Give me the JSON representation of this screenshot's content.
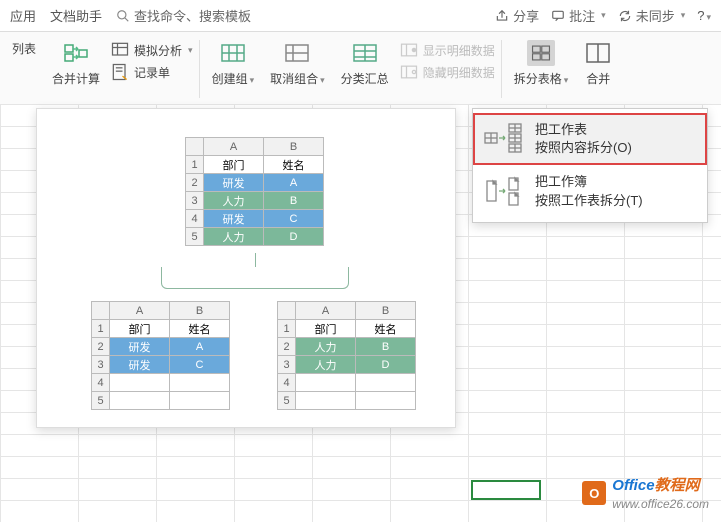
{
  "topbar": {
    "app": "应用",
    "doc_helper": "文档助手",
    "search_placeholder": "查找命令、搜索模板",
    "share": "分享",
    "comment": "批注",
    "sync": "未同步",
    "help": "?"
  },
  "ribbon": {
    "item1": "列表",
    "item2": "合并计算",
    "sim": "模拟分析",
    "record": "记录单",
    "create_group": "创建组",
    "ungroup": "取消组合",
    "subtotal": "分类汇总",
    "show_detail": "显示明细数据",
    "hide_detail": "隐藏明细数据",
    "split_table": "拆分表格",
    "merge": "合并"
  },
  "preview_main": {
    "colA": "A",
    "colB": "B",
    "rows": [
      {
        "n": "1",
        "a": "部门",
        "b": "姓名"
      },
      {
        "n": "2",
        "a": "研发",
        "b": "A"
      },
      {
        "n": "3",
        "a": "人力",
        "b": "B"
      },
      {
        "n": "4",
        "a": "研发",
        "b": "C"
      },
      {
        "n": "5",
        "a": "人力",
        "b": "D"
      }
    ]
  },
  "preview_left": {
    "colA": "A",
    "colB": "B",
    "rows": [
      {
        "n": "1",
        "a": "部门",
        "b": "姓名"
      },
      {
        "n": "2",
        "a": "研发",
        "b": "A"
      },
      {
        "n": "3",
        "a": "研发",
        "b": "C"
      },
      {
        "n": "4",
        "a": "",
        "b": ""
      },
      {
        "n": "5",
        "a": "",
        "b": ""
      }
    ]
  },
  "preview_right": {
    "colA": "A",
    "colB": "B",
    "rows": [
      {
        "n": "1",
        "a": "部门",
        "b": "姓名"
      },
      {
        "n": "2",
        "a": "人力",
        "b": "B"
      },
      {
        "n": "3",
        "a": "人力",
        "b": "D"
      },
      {
        "n": "4",
        "a": "",
        "b": ""
      },
      {
        "n": "5",
        "a": "",
        "b": ""
      }
    ]
  },
  "split_menu": {
    "opt1_l1": "把工作表",
    "opt1_l2": "按照内容拆分(O)",
    "opt2_l1": "把工作簿",
    "opt2_l2": "按照工作表拆分(T)"
  },
  "watermark": {
    "brand1": "Office",
    "brand2": "教程网",
    "url": "www.office26.com"
  }
}
